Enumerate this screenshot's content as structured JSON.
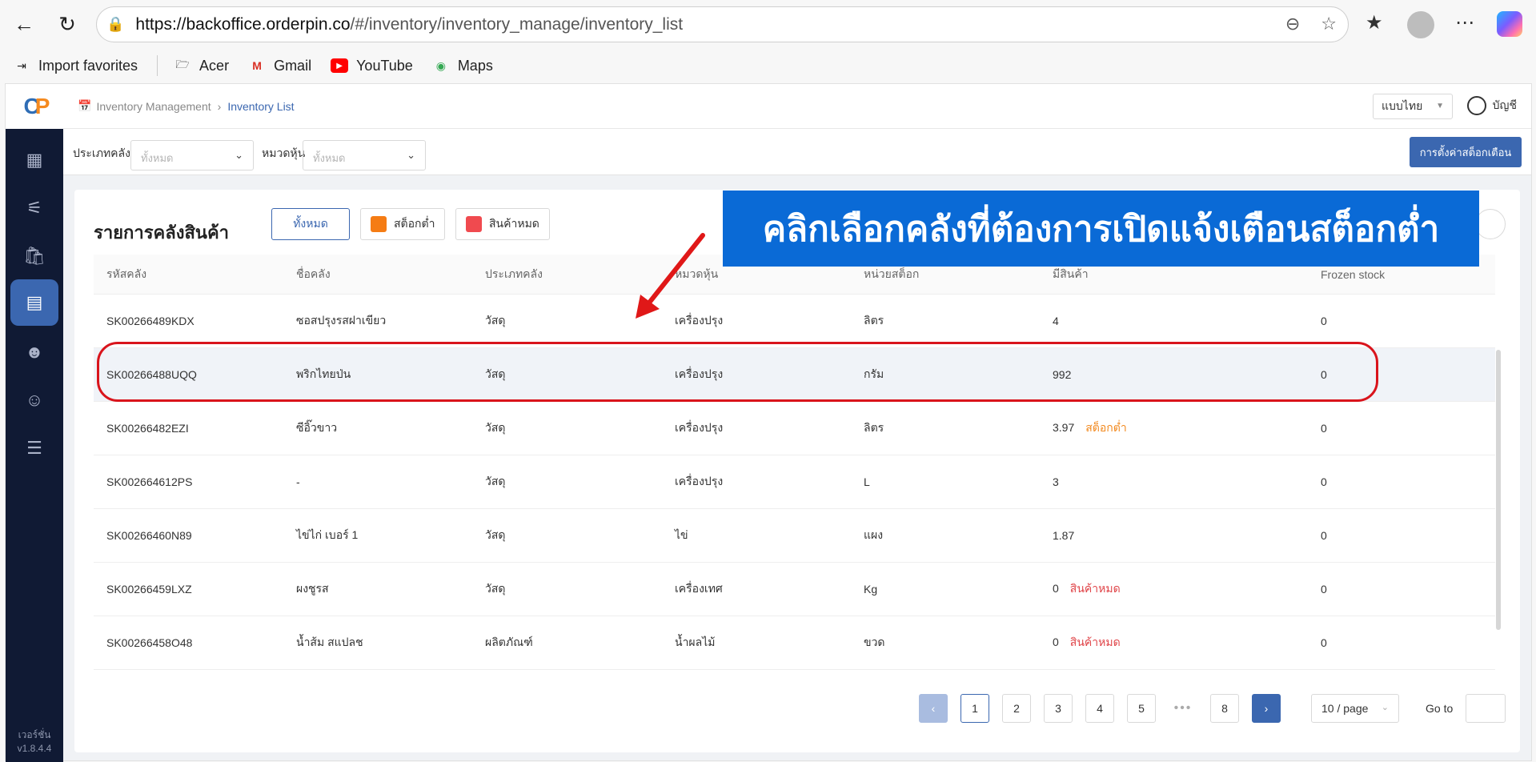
{
  "browser": {
    "url_host": "https://backoffice.orderpin.co",
    "url_path": "/#/inventory/inventory_manage/inventory_list",
    "bookmarks": [
      "Import favorites",
      "Acer",
      "Gmail",
      "YouTube",
      "Maps"
    ]
  },
  "app": {
    "breadcrumb": [
      "Inventory Management",
      "Inventory List"
    ],
    "language": "แบบไทย",
    "account": "บัญชี",
    "version_label": "เวอร์ชั่น",
    "version": "v1.8.4.4"
  },
  "filters": {
    "warehouse_type_label": "ประเภทคลัง",
    "warehouse_type_value": "ทั้งหมด",
    "category_label": "หมวดหุ้น",
    "category_value": "ทั้งหมด",
    "settings_button": "การตั้งค่าสต็อกเตือน"
  },
  "card": {
    "title": "รายการคลังสินค้า",
    "chips": [
      {
        "label": "ทั้งหมด",
        "color": ""
      },
      {
        "label": "สต็อกต่ำ",
        "color": "#f57c14"
      },
      {
        "label": "สินค้าหมด",
        "color": "#f04a4f"
      }
    ]
  },
  "table": {
    "headers": [
      "รหัสคลัง",
      "ชื่อคลัง",
      "ประเภทคลัง",
      "หมวดหุ้น",
      "หน่วยสต็อก",
      "มีสินค้า",
      "Frozen stock"
    ],
    "rows": [
      {
        "code": "SK00266489KDX",
        "name": "ซอสปรุงรสฝาเขียว",
        "type": "วัสดุ",
        "category": "เครื่องปรุง",
        "unit": "ลิตร",
        "qty": "4",
        "tag": "",
        "frozen": "0"
      },
      {
        "code": "SK00266488UQQ",
        "name": "พริกไทยป่น",
        "type": "วัสดุ",
        "category": "เครื่องปรุง",
        "unit": "กรัม",
        "qty": "992",
        "tag": "",
        "frozen": "0"
      },
      {
        "code": "SK00266482EZI",
        "name": "ซีอิ๊วขาว",
        "type": "วัสดุ",
        "category": "เครื่องปรุง",
        "unit": "ลิตร",
        "qty": "3.97",
        "tag": "สต็อกต่ำ",
        "frozen": "0"
      },
      {
        "code": "SK002664612PS",
        "name": "-",
        "type": "วัสดุ",
        "category": "เครื่องปรุง",
        "unit": "L",
        "qty": "3",
        "tag": "",
        "frozen": "0"
      },
      {
        "code": "SK00266460N89",
        "name": "ไข่ไก่ เบอร์ 1",
        "type": "วัสดุ",
        "category": "ไข่",
        "unit": "แผง",
        "qty": "1.87",
        "tag": "",
        "frozen": "0"
      },
      {
        "code": "SK00266459LXZ",
        "name": "ผงชูรส",
        "type": "วัสดุ",
        "category": "เครื่องเทศ",
        "unit": "Kg",
        "qty": "0",
        "tag": "สินค้าหมด",
        "frozen": "0"
      },
      {
        "code": "SK00266458O48",
        "name": "น้ำส้ม สแปลช",
        "type": "ผลิตภัณฑ์",
        "category": "น้ำผลไม้",
        "unit": "ขวด",
        "qty": "0",
        "tag": "สินค้าหมด",
        "frozen": "0"
      }
    ]
  },
  "pagination": {
    "pages": [
      "1",
      "2",
      "3",
      "4",
      "5",
      "8"
    ],
    "current": "1",
    "dots": "•••",
    "prev": "‹",
    "next": "›",
    "page_size": "10 / page",
    "goto_label": "Go to"
  },
  "annotation": {
    "banner_text": "คลิกเลือกคลังที่ต้องการเปิดแจ้งเตือนสต็อกต่ำ",
    "highlighted_row_index": 1
  }
}
